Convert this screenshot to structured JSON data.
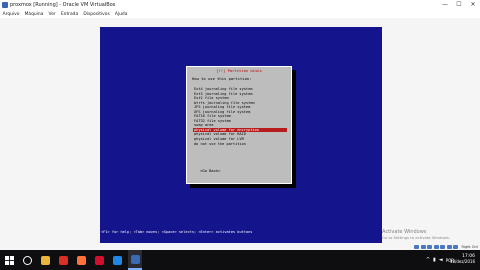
{
  "window": {
    "title": "proxmox [Running] - Oracle VM VirtualBox",
    "controls": {
      "minimize": "—",
      "maximize": "☐",
      "close": "✕"
    }
  },
  "menu": [
    "Arquivo",
    "Máquina",
    "Ver",
    "Entrada",
    "Dispositivos",
    "Ajuda"
  ],
  "installer": {
    "title": "[!!] Partition disks",
    "prompt": "How to use this partition:",
    "options": [
      "Ext4 journaling file system",
      "Ext3 journaling file system",
      "Ext2 file system",
      "btrfs journaling file system",
      "JFS journaling file system",
      "XFS journaling file system",
      "FAT16 file system",
      "FAT32 file system",
      "swap area",
      "physical volume for encryption",
      "physical volume for RAID",
      "physical volume for LVM",
      "do not use the partition"
    ],
    "selected_index": 9,
    "go_back": "<Go Back>",
    "help_line": "<F1> for help; <Tab> moves; <Space> selects; <Enter> activates buttons"
  },
  "activation": {
    "title": "Activate Windows",
    "subtitle": "Go to Settings to activate Windows."
  },
  "vm_status": {
    "host_key": "Right Ctrl"
  },
  "taskbar": {
    "items": [
      {
        "name": "search-icon",
        "color": "#ffffff"
      },
      {
        "name": "file-explorer-icon",
        "color": "#e8b43a"
      },
      {
        "name": "chrome-icon",
        "color": "#d93025"
      },
      {
        "name": "firefox-icon",
        "color": "#ff7139"
      },
      {
        "name": "opera-icon",
        "color": "#d0102c"
      },
      {
        "name": "app-icon",
        "color": "#1e88e5"
      },
      {
        "name": "virtualbox-icon",
        "color": "#3b6ab5"
      }
    ],
    "lang": "POR",
    "time": "17:06",
    "date": "18/dez/2016"
  }
}
